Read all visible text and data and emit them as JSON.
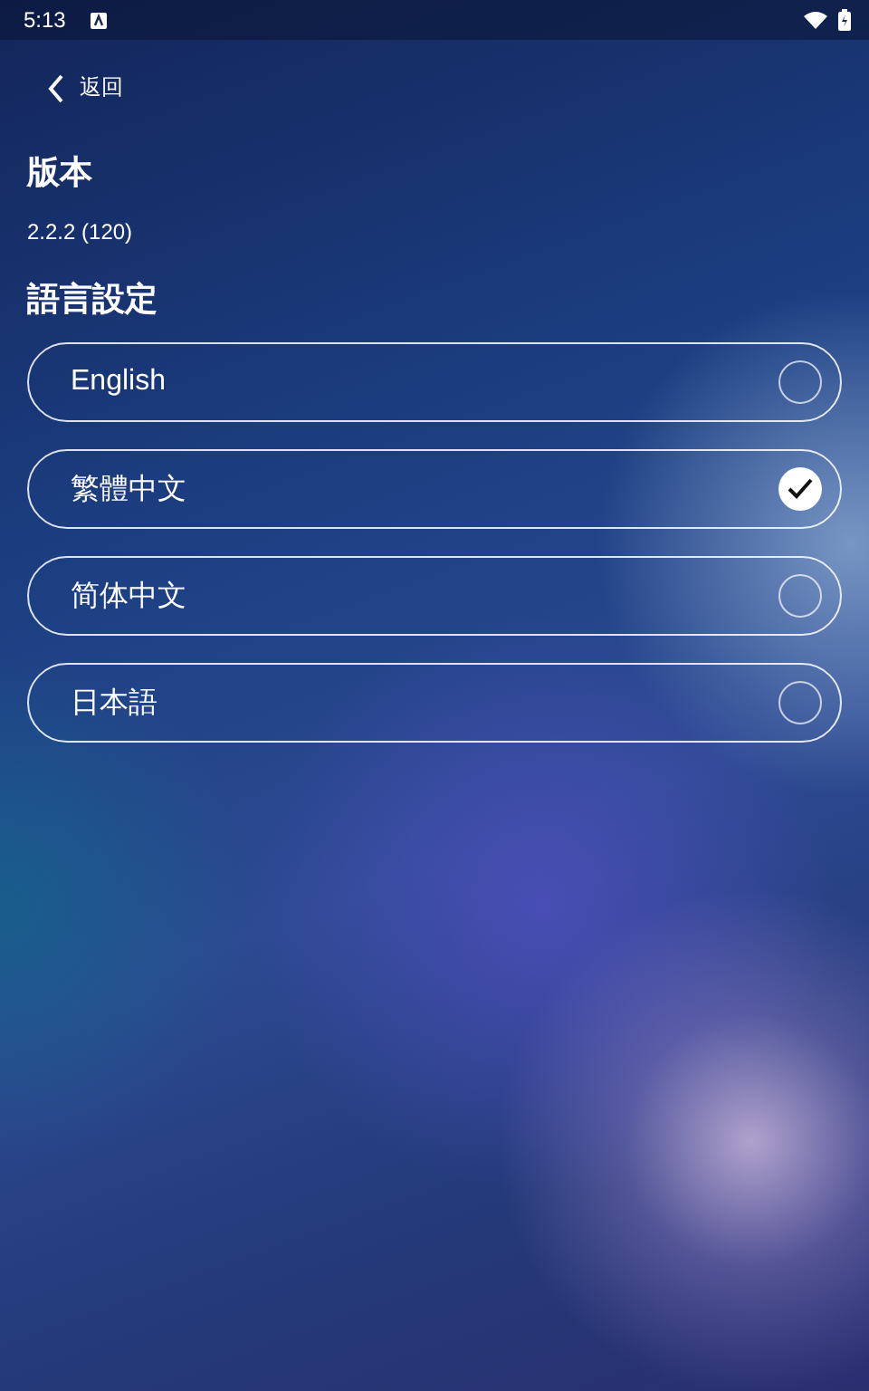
{
  "status_bar": {
    "time": "5:13"
  },
  "header": {
    "back_label": "返回"
  },
  "version": {
    "title": "版本",
    "value": "2.2.2 (120)"
  },
  "language": {
    "title": "語言設定",
    "options": [
      {
        "label": "English",
        "selected": false
      },
      {
        "label": "繁體中文",
        "selected": true
      },
      {
        "label": "简体中文",
        "selected": false
      },
      {
        "label": "日本語",
        "selected": false
      }
    ]
  }
}
